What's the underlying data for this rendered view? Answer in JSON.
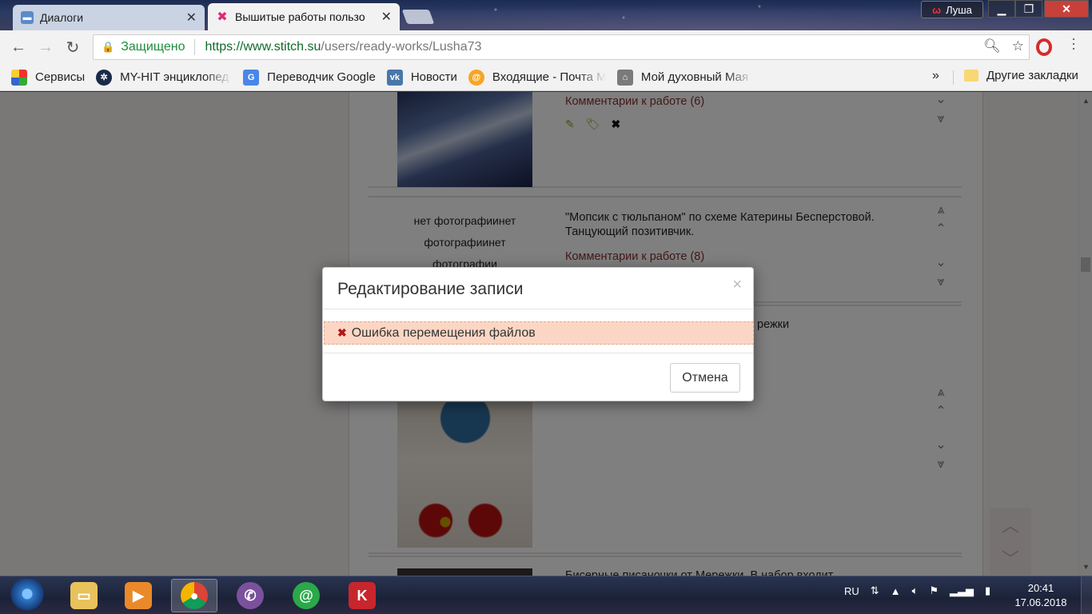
{
  "browser": {
    "tabs": [
      {
        "title": "Диалоги",
        "icon": "chat-icon",
        "active": false
      },
      {
        "title": "Вышитые работы пользо",
        "icon": "stitch-logo-icon",
        "active": true
      }
    ],
    "profile_name": "Луша",
    "security_label": "Защищено",
    "url_host": "https://www.stitch.su",
    "url_path": "/users/ready-works/Lusha73"
  },
  "bookmarks": {
    "items": [
      {
        "label": "Сервисы",
        "icon": "apps-grid-icon"
      },
      {
        "label": "MY-HIT энциклопед",
        "icon": "film-reel-icon"
      },
      {
        "label": "Переводчик Google",
        "icon": "google-translate-icon"
      },
      {
        "label": "Новости",
        "icon": "vk-icon"
      },
      {
        "label": "Входящие - Почта M",
        "icon": "mail-at-icon"
      },
      {
        "label": "Мой духовный Мая",
        "icon": "lighthouse-icon"
      }
    ],
    "more": "»",
    "other_label": "Другие закладки"
  },
  "page": {
    "works": [
      {
        "comments_link": "Комментарии к работе (6)"
      },
      {
        "no_photo": "нет фотографиинет фотографиинет фотографии",
        "description": "\"Мопсик с тюльпаном\" по схеме Катерины Бесперстовой. Танцующий позитивчик.",
        "comments_link": "Комментарии к работе (8)"
      },
      {
        "description_tail": "режки"
      },
      {
        "description": "Бисерные писаночки от Мережки. В набор входит"
      }
    ]
  },
  "modal": {
    "title": "Редактирование записи",
    "close": "×",
    "error_message": "Ошибка перемещения файлов",
    "cancel_label": "Отмена"
  },
  "taskbar": {
    "apps": [
      "file-explorer-icon",
      "media-player-icon",
      "chrome-icon",
      "viber-icon",
      "mail-agent-icon",
      "app-red-icon"
    ],
    "language": "RU",
    "time": "20:41",
    "date": "17.06.2018"
  },
  "colors": {
    "error_bg": "#fcd6c4",
    "error_icon": "#b0161a",
    "link": "#8a3030",
    "secure": "#1e8e3e"
  }
}
